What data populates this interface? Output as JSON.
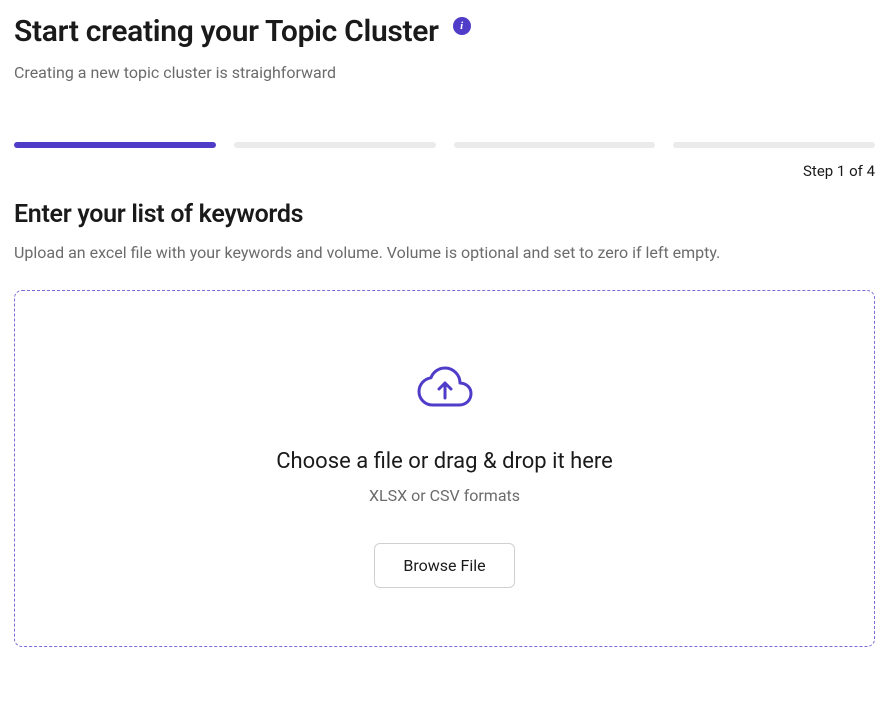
{
  "header": {
    "title": "Start creating your Topic Cluster",
    "subtitle": "Creating a new topic cluster is straighforward"
  },
  "progress": {
    "current_step": 1,
    "total_steps": 4,
    "label": "Step 1 of 4"
  },
  "section": {
    "title": "Enter your list of keywords",
    "subtitle": "Upload an excel file with your keywords and volume. Volume is optional and set to zero if left empty."
  },
  "dropzone": {
    "title": "Choose a file or drag & drop it here",
    "formats": "XLSX or CSV formats",
    "button_label": "Browse File"
  },
  "colors": {
    "accent": "#4f3cc9",
    "border_dashed": "#7b68d9"
  }
}
